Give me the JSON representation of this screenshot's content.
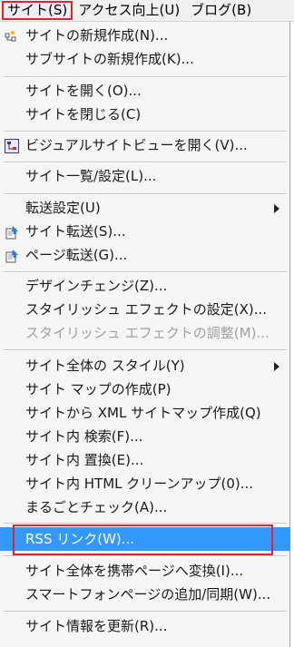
{
  "menubar": {
    "items": [
      "サイト(S)",
      "アクセス向上(U)",
      "ブログ(B)"
    ]
  },
  "menu": {
    "items": [
      {
        "label": "サイトの新規作成(N)...",
        "icon": "new-site-icon"
      },
      {
        "label": "サブサイトの新規作成(K)..."
      },
      {
        "label": "サイトを開く(O)..."
      },
      {
        "label": "サイトを閉じる(C)"
      },
      {
        "label": "ビジュアルサイトビューを開く(V)...",
        "icon": "visual-site-view-icon"
      },
      {
        "label": "サイト一覧/設定(L)..."
      },
      {
        "label": "転送設定(U)",
        "submenu": true
      },
      {
        "label": "サイト転送(S)...",
        "icon": "site-transfer-icon"
      },
      {
        "label": "ページ転送(G)...",
        "icon": "page-transfer-icon"
      },
      {
        "label": "デザインチェンジ(Z)..."
      },
      {
        "label": "スタイリッシュ エフェクトの設定(X)..."
      },
      {
        "label": "スタイリッシュ エフェクトの調整(M)...",
        "disabled": true
      },
      {
        "label": "サイト全体の スタイル(Y)",
        "submenu": true
      },
      {
        "label": "サイト マップの作成(P)"
      },
      {
        "label": "サイトから XML サイトマップ作成(Q)"
      },
      {
        "label": "サイト内 検索(F)..."
      },
      {
        "label": "サイト内 置換(E)..."
      },
      {
        "label": "サイト内 HTML クリーンアップ(0)..."
      },
      {
        "label": "まるごとチェック(A)..."
      },
      {
        "label": "RSS リンク(W)...",
        "highlighted": true
      },
      {
        "label": "サイト全体を携帯ページへ変換(I)..."
      },
      {
        "label": "スマートフォンページの追加/同期(W)..."
      },
      {
        "label": "サイト情報を更新(R)..."
      }
    ]
  },
  "colors": {
    "highlight": "#3399ff",
    "callout_border": "#e0262b",
    "disabled_text": "#a0a0a0"
  }
}
